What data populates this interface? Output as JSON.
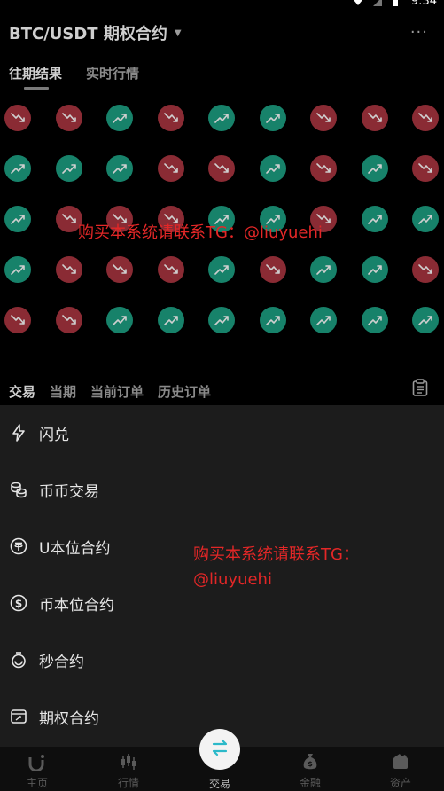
{
  "status": {
    "time": "9:34"
  },
  "header": {
    "title": "BTC/USDT 期权合约"
  },
  "tabs": [
    {
      "label": "往期结果"
    },
    {
      "label": "实时行情"
    }
  ],
  "results_grid": [
    [
      "down",
      "down",
      "up",
      "down",
      "up",
      "up",
      "down",
      "down",
      "down"
    ],
    [
      "up",
      "up",
      "up",
      "down",
      "down",
      "up",
      "down",
      "up",
      "down"
    ],
    [
      "up",
      "down",
      "down",
      "down",
      "up",
      "up",
      "down",
      "up",
      "up"
    ],
    [
      "up",
      "down",
      "down",
      "down",
      "up",
      "down",
      "up",
      "up",
      "down"
    ],
    [
      "down",
      "down",
      "up",
      "up",
      "up",
      "up",
      "up",
      "up",
      "up"
    ]
  ],
  "watermark": {
    "line1": "购买本系统请联系TG：@liuyuehi",
    "line2a": "购买本系统请联系TG：",
    "line2b": "@liuyuehi"
  },
  "order_tabs": [
    {
      "label": "交易"
    },
    {
      "label": "当期"
    },
    {
      "label": "当前订单"
    },
    {
      "label": "历史订单"
    }
  ],
  "sheet_items": [
    {
      "label": "闪兑",
      "icon": "lightning-icon"
    },
    {
      "label": "币币交易",
      "icon": "coins-icon"
    },
    {
      "label": "U本位合约",
      "icon": "tether-icon"
    },
    {
      "label": "币本位合约",
      "icon": "dollar-icon"
    },
    {
      "label": "秒合约",
      "icon": "stopwatch-icon"
    },
    {
      "label": "期权合约",
      "icon": "option-icon"
    }
  ],
  "bottom_nav": [
    {
      "label": "主页"
    },
    {
      "label": "行情"
    },
    {
      "label": "交易"
    },
    {
      "label": "金融"
    },
    {
      "label": "资产"
    }
  ],
  "colors": {
    "up": "#17826a",
    "down": "#8a2b34",
    "watermark": "#e32727"
  }
}
